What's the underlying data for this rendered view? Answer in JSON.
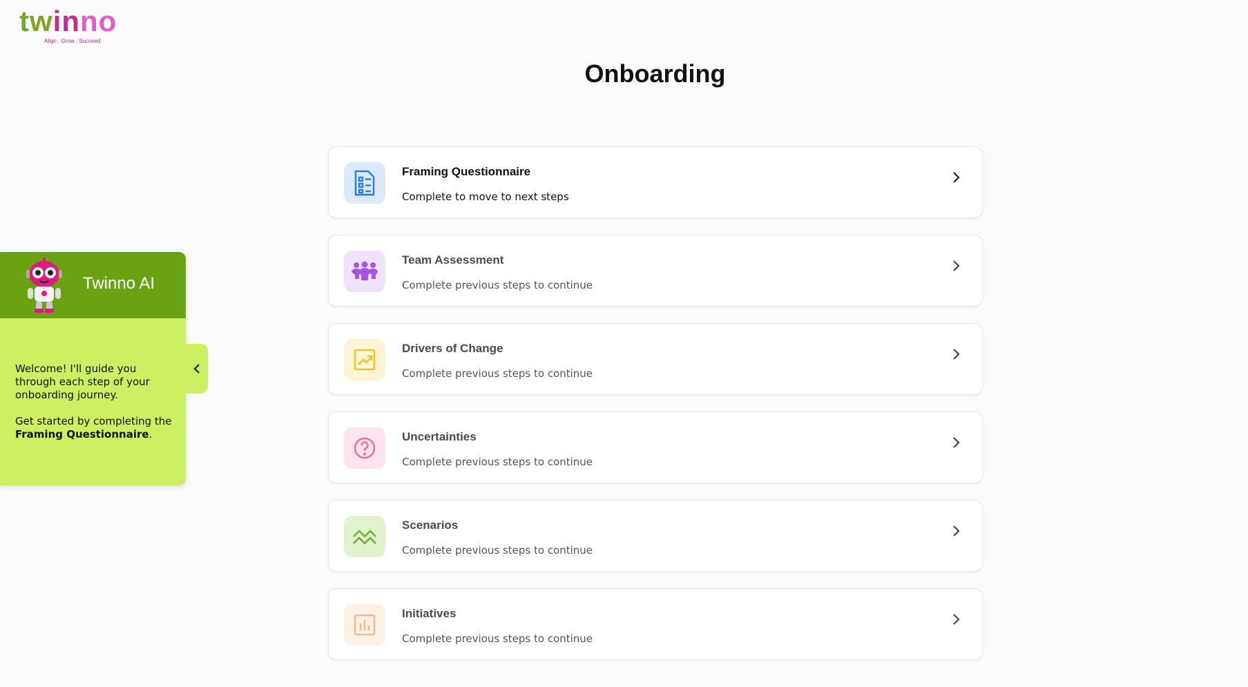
{
  "logo": {
    "part1": "tw",
    "part2": "in",
    "part3": "no",
    "tagline": "Align . Grow . Succeed"
  },
  "page": {
    "title": "Onboarding"
  },
  "steps": [
    {
      "title": "Framing Questionnaire",
      "subtitle": "Complete to move to next steps",
      "icon": "checklist-icon",
      "state": "active",
      "accent": "#2b7be0",
      "bg": "#dbe9f9"
    },
    {
      "title": "Team Assessment",
      "subtitle": "Complete previous steps to continue",
      "icon": "team-icon",
      "state": "locked",
      "accent": "#a455e8",
      "bg": "#efe2fb"
    },
    {
      "title": "Drivers of Change",
      "subtitle": "Complete previous steps to continue",
      "icon": "trend-up-icon",
      "state": "locked",
      "accent": "#e7c52a",
      "bg": "#fbf5d6"
    },
    {
      "title": "Uncertainties",
      "subtitle": "Complete previous steps to continue",
      "icon": "question-icon",
      "state": "locked",
      "accent": "#ee6fa3",
      "bg": "#fde4ee"
    },
    {
      "title": "Scenarios",
      "subtitle": "Complete previous steps to continue",
      "icon": "zigzag-icon",
      "state": "locked",
      "accent": "#7ab33a",
      "bg": "#e2f2cf"
    },
    {
      "title": "Initiatives",
      "subtitle": "Complete previous steps to continue",
      "icon": "bar-chart-icon",
      "state": "locked",
      "accent": "#f2b98a",
      "bg": "#fdf1e6"
    }
  ],
  "assistant": {
    "name": "Twinno AI",
    "message_line1": "Welcome! I'll guide you through each step of your onboarding journey.",
    "message_prefix": "Get started by completing the ",
    "message_bold": "Framing Questionnaire",
    "message_suffix": "."
  },
  "colors": {
    "assistant_header": "#6aa312",
    "assistant_body": "#cdf062",
    "page_bg": "#fafafa"
  }
}
